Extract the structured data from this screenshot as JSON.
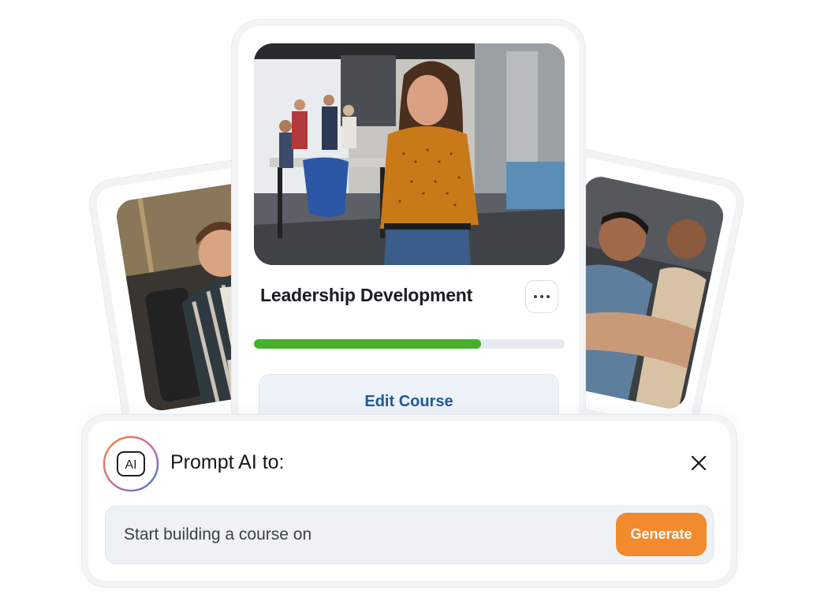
{
  "course_card": {
    "title": "Leadership Development",
    "progress_percent": 73,
    "edit_label": "Edit Course",
    "more_icon": "ellipsis-icon"
  },
  "prompt": {
    "badge_text": "AI",
    "label": "Prompt AI to:",
    "input_value": "Start building a course on",
    "generate_label": "Generate",
    "close_icon": "close-icon"
  },
  "colors": {
    "progress": "#45b02a",
    "generate": "#f28a2e",
    "edit_text": "#1e5aa0"
  }
}
